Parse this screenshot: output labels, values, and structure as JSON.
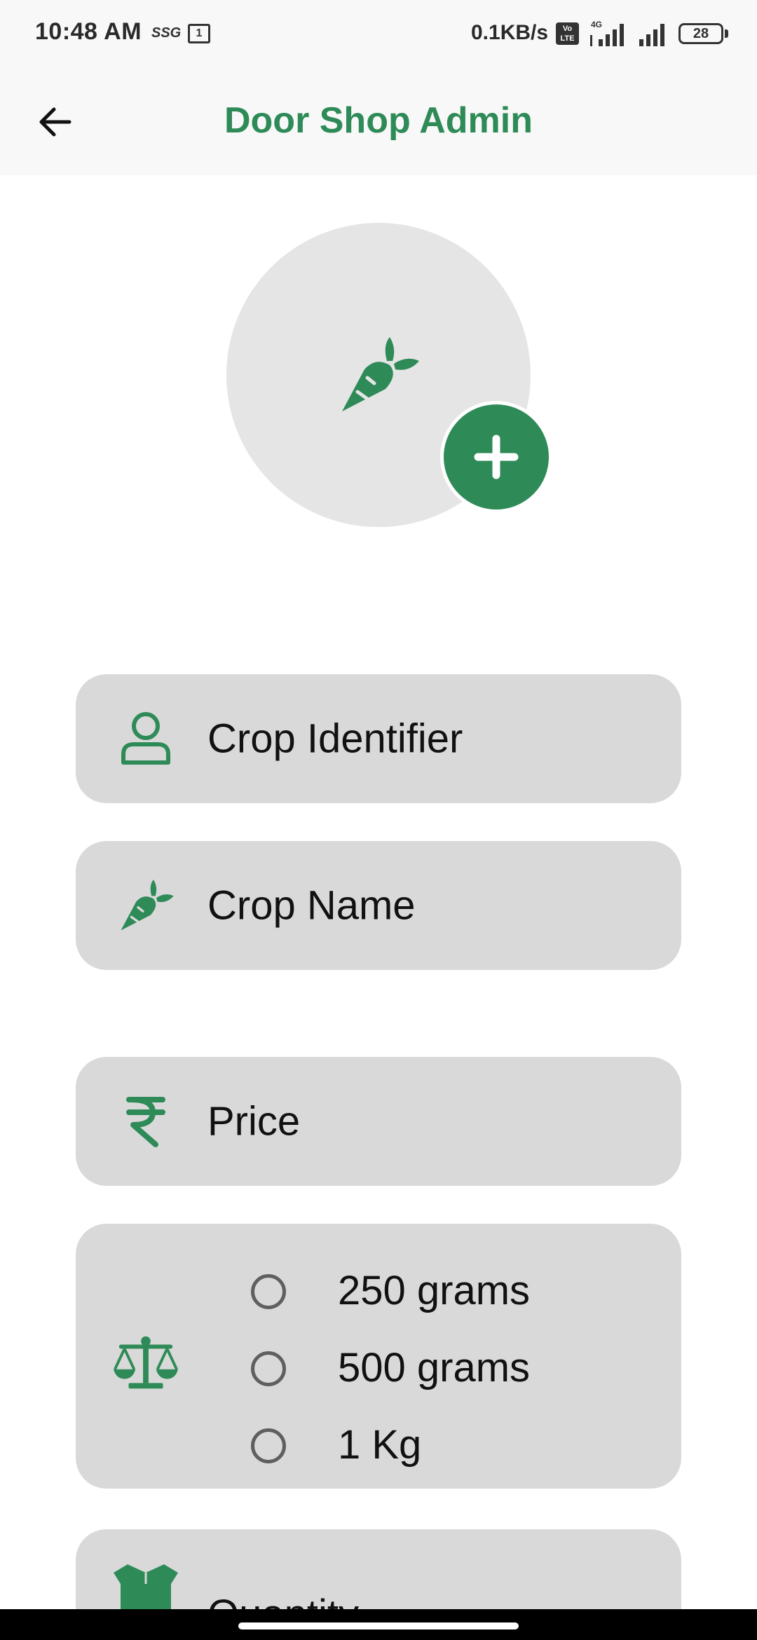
{
  "status_bar": {
    "time": "10:48 AM",
    "ssg": "SSG",
    "calendar_day": "1",
    "network_speed": "0.1KB/s",
    "volte": "Vo LTE",
    "network_type": "4G",
    "battery": "28"
  },
  "app_bar": {
    "title": "Door Shop Admin",
    "back_icon": "arrow-left-icon"
  },
  "image_picker": {
    "placeholder_icon": "carrot-icon",
    "add_icon": "plus-icon"
  },
  "form": {
    "crop_identifier": {
      "icon": "person-icon",
      "placeholder": "Crop Identifier"
    },
    "crop_name": {
      "icon": "carrot-icon",
      "placeholder": "Crop Name"
    },
    "price": {
      "icon": "rupee-icon",
      "placeholder": "Price"
    },
    "weight": {
      "icon": "balance-scale-icon",
      "options": [
        {
          "label": "250 grams",
          "selected": false
        },
        {
          "label": "500 grams",
          "selected": false
        },
        {
          "label": "1 Kg",
          "selected": false
        }
      ]
    },
    "quantity": {
      "icon": "box-open-icon",
      "placeholder": "Quantity"
    }
  },
  "colors": {
    "accent": "#2e8b57",
    "field_bg": "#d9d9d9",
    "avatar_bg": "#e5e5e5",
    "bar_bg": "#f8f8f8"
  }
}
